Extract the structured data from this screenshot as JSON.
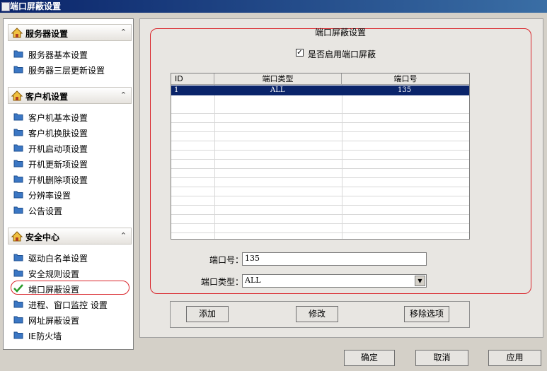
{
  "window": {
    "title": "端口屏蔽设置"
  },
  "sidebar": {
    "groups": [
      {
        "title": "服务器设置",
        "items": [
          "服务器基本设置",
          "服务器三层更新设置"
        ]
      },
      {
        "title": "客户机设置",
        "items": [
          "客户机基本设置",
          "客户机换肤设置",
          "开机启动项设置",
          "开机更新项设置",
          "开机删除项设置",
          "分辨率设置",
          "公告设置"
        ]
      },
      {
        "title": "安全中心",
        "items": [
          "驱动白名单设置",
          "安全规则设置",
          "端口屏蔽设置",
          "进程、窗口监控 设置",
          "网址屏蔽设置",
          "IE防火墙"
        ]
      }
    ],
    "selected": "端口屏蔽设置"
  },
  "panel": {
    "title": "端口屏蔽设置",
    "enable_label": "是否启用端口屏蔽",
    "enable_checked": true,
    "table": {
      "headers": [
        "ID",
        "端口类型",
        "端口号"
      ],
      "rows": [
        [
          "1",
          "ALL",
          "135"
        ]
      ]
    },
    "port_label": "端口号：",
    "port_value": "135",
    "type_label": "端口类型：",
    "type_value": "ALL",
    "buttons": {
      "add": "添加",
      "modify": "修改",
      "remove": "移除选项"
    }
  },
  "footer": {
    "ok": "确定",
    "cancel": "取消",
    "apply": "应用"
  },
  "colors": {
    "titlebar": "#0a246a",
    "highlight": "#d9262c",
    "selection": "#0a246a"
  }
}
